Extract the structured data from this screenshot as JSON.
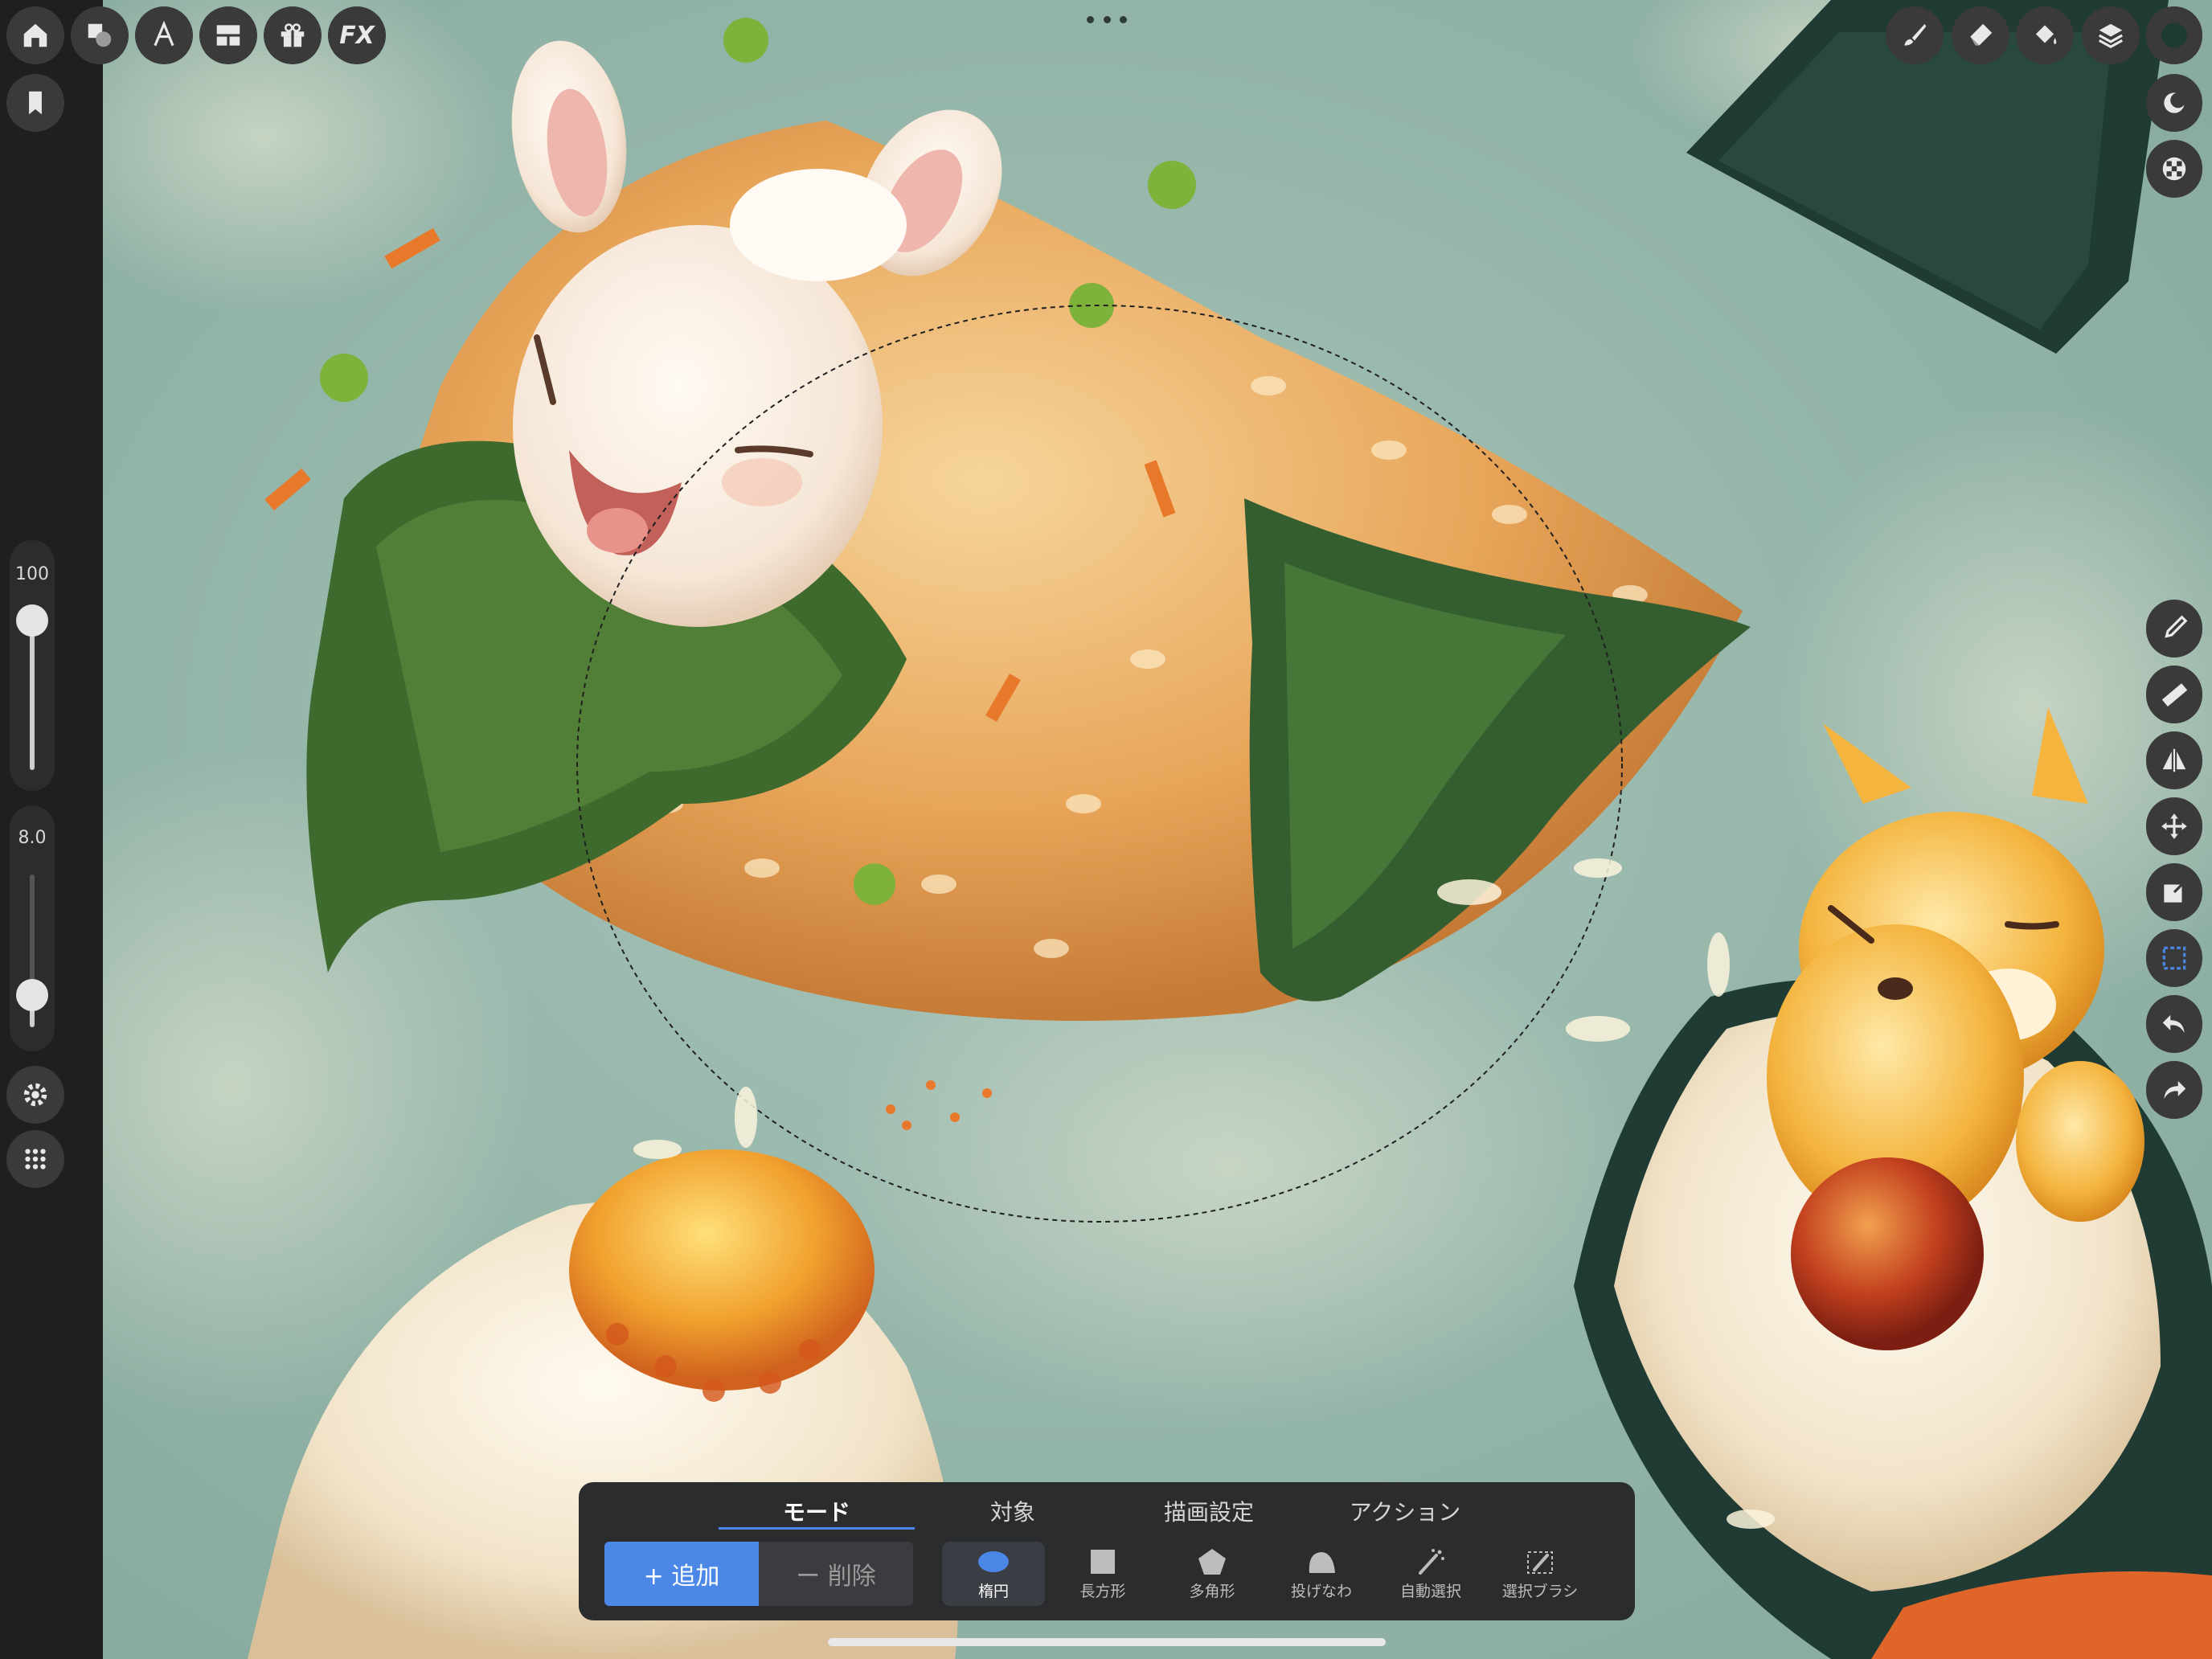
{
  "app": {
    "left_toolbar": {
      "top_icons": [
        "home-icon",
        "shapes-icon",
        "text-icon",
        "gallery-icon",
        "gift-icon",
        "fx-icon"
      ],
      "fx_label": "FX",
      "bookmark_icon": "bookmark-icon",
      "size_slider": {
        "value_label": "100",
        "level": 1.0
      },
      "opacity_slider": {
        "value_label": "8.0",
        "level": 0.08
      },
      "bottom_icons": [
        "settings-icon",
        "apps-grid-icon"
      ]
    },
    "right_toolbar": {
      "top_icons": [
        "brush-icon",
        "eraser-icon",
        "fill-icon",
        "layers-icon",
        "color-swatch-icon"
      ],
      "side_icons": [
        "mask-icon",
        "checker-icon"
      ],
      "tools": [
        "eyedropper-icon",
        "ruler-icon",
        "mirror-icon",
        "move-icon",
        "transform-icon",
        "selection-icon",
        "undo-icon",
        "redo-icon"
      ]
    },
    "selection_panel": {
      "tabs": [
        {
          "label": "モード",
          "active": true
        },
        {
          "label": "対象",
          "active": false
        },
        {
          "label": "描画設定",
          "active": false
        },
        {
          "label": "アクション",
          "active": false
        }
      ],
      "add_label": "+ 追加",
      "delete_label": "ー 削除",
      "tools": [
        {
          "label": "楕円",
          "icon": "ellipse-icon",
          "active": true
        },
        {
          "label": "長方形",
          "icon": "rectangle-icon",
          "active": false
        },
        {
          "label": "多角形",
          "icon": "polygon-icon",
          "active": false
        },
        {
          "label": "投げなわ",
          "icon": "lasso-icon",
          "active": false
        },
        {
          "label": "自動選択",
          "icon": "magic-wand-icon",
          "active": false
        },
        {
          "label": "選択ブラシ",
          "icon": "selection-brush-icon",
          "active": false
        }
      ]
    },
    "colors": {
      "accent": "#4a87e6",
      "panel": "#2b2c2e",
      "toolbar": "#1f1f1f"
    }
  }
}
